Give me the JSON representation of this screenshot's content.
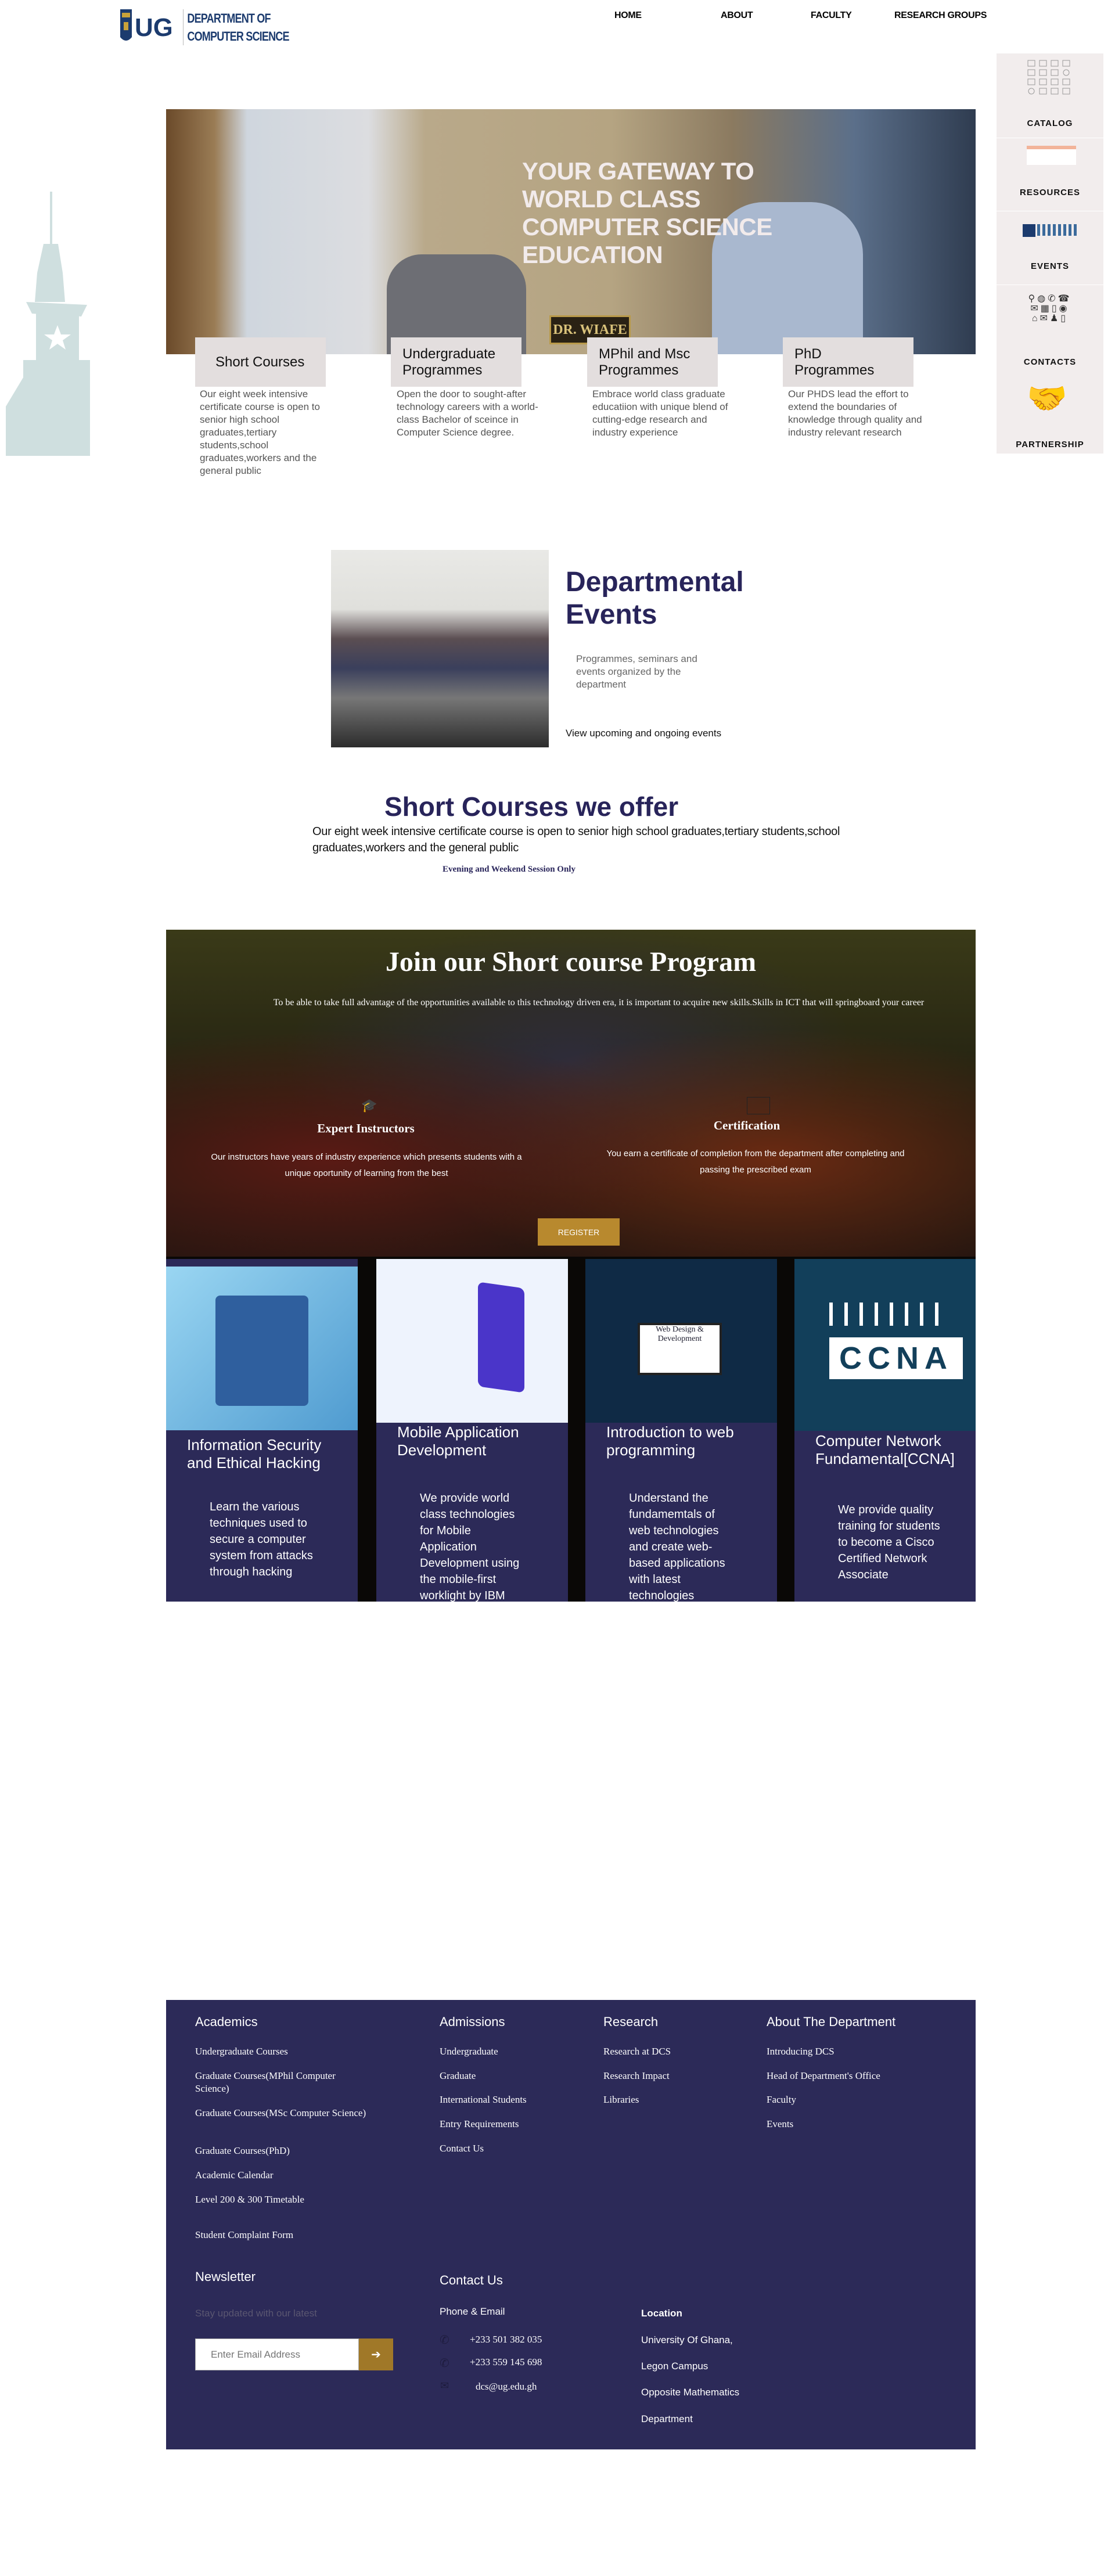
{
  "header": {
    "logo_mark": "UG",
    "logo_line1": "DEPARTMENT OF",
    "logo_line2": "COMPUTER SCIENCE",
    "nav": [
      "HOME",
      "ABOUT",
      "FACULTY",
      "RESEARCH GROUPS"
    ]
  },
  "sidebar": [
    "CATALOG",
    "RESOURCES",
    "EVENTS",
    "CONTACTS",
    "PARTNERSHIP"
  ],
  "hero": {
    "title": "YOUR GATEWAY TO WORLD CLASS COMPUTER SCIENCE EDUCATION",
    "nameplate": "DR. WIAFE"
  },
  "programmes": [
    {
      "title": "Short Courses",
      "desc": "Our eight week intensive certificate course is open to senior high school graduates,tertiary students,school graduates,workers and the general public"
    },
    {
      "title": "Undergraduate Programmes",
      "desc": "Open the door to sought-after technology careers with a world-class Bachelor of sceince in Computer Science degree."
    },
    {
      "title": "MPhil and Msc Programmes",
      "desc": "Embrace world class graduate educatiion with unique blend of cutting-edge research and industry experience"
    },
    {
      "title": "PhD Programmes",
      "desc": "Our PHDS lead the effort to extend the boundaries of knowledge through quality and industry relevant research"
    }
  ],
  "events": {
    "title": "Departmental Events",
    "desc": "Programmes, seminars and events organized by the department",
    "link": "View upcoming and ongoing events"
  },
  "short_courses": {
    "title": "Short Courses we offer",
    "desc": "Our eight week intensive certificate course is open to senior high school graduates,tertiary students,school graduates,workers and the general public",
    "session": "Evening and Weekend Session Only"
  },
  "join": {
    "title": "Join our Short course Program",
    "desc": "To be able to take full advantage of the opportunities available to this technology driven era, it is important to acquire new skills.Skills in ICT that will springboard your career",
    "features": [
      {
        "title": "Expert Instructors",
        "desc": "Our instructors have years of industry experience which presents students with a unique oportunity of learning from the best"
      },
      {
        "title": "Certification",
        "desc": "You earn a certificate of completion from the department after completing and passing the prescribed exam"
      }
    ],
    "register": "REGISTER"
  },
  "courses": [
    {
      "title": "Information Security and Ethical Hacking",
      "desc": "Learn the various techniques used to secure a computer system from attacks through hacking"
    },
    {
      "title": "Mobile Application Development",
      "desc": "We provide world class technologies for Mobile Application Development using the mobile-first worklight by IBM"
    },
    {
      "title": "Introduction to web programming",
      "desc": "Understand the fundamemtals of web technologies and create web-based applications with latest technologies",
      "image_text": "Web Design & Development"
    },
    {
      "title": "Computer Network Fundamental[CCNA]",
      "desc": "We provide quality training for students to become a Cisco Certified Network Associate",
      "image_text": "CCNA"
    }
  ],
  "footer": {
    "academics": {
      "title": "Academics",
      "links": [
        "Undergraduate Courses",
        "Graduate Courses(MPhil Computer Science)",
        "Graduate Courses(MSc Computer Science)",
        "Graduate Courses(PhD)",
        "Academic Calendar",
        "Level 200 & 300 Timetable",
        "Student Complaint Form"
      ]
    },
    "admissions": {
      "title": "Admissions",
      "links": [
        "Undergraduate",
        "Graduate",
        "International Students",
        "Entry Requirements",
        "Contact Us"
      ]
    },
    "research": {
      "title": "Research",
      "links": [
        "Research at DCS",
        "Research Impact",
        "Libraries"
      ]
    },
    "about": {
      "title": "About The Department",
      "links": [
        "Introducing DCS",
        "Head of Department's Office",
        "Faculty",
        "Events"
      ]
    },
    "newsletter": {
      "title": "Newsletter",
      "desc": "Stay updated with our latest",
      "placeholder": "Enter Email Address",
      "submit": "➔"
    },
    "contact": {
      "title": "Contact Us",
      "phone_email_title": "Phone & Email",
      "phones": [
        "+233 501 382 035",
        "+233 559 145 698"
      ],
      "email": "dcs@ug.edu.gh",
      "location_title": "Location",
      "location": [
        "University Of Ghana,",
        "Legon Campus",
        "Opposite Mathematics",
        "Department"
      ]
    }
  }
}
